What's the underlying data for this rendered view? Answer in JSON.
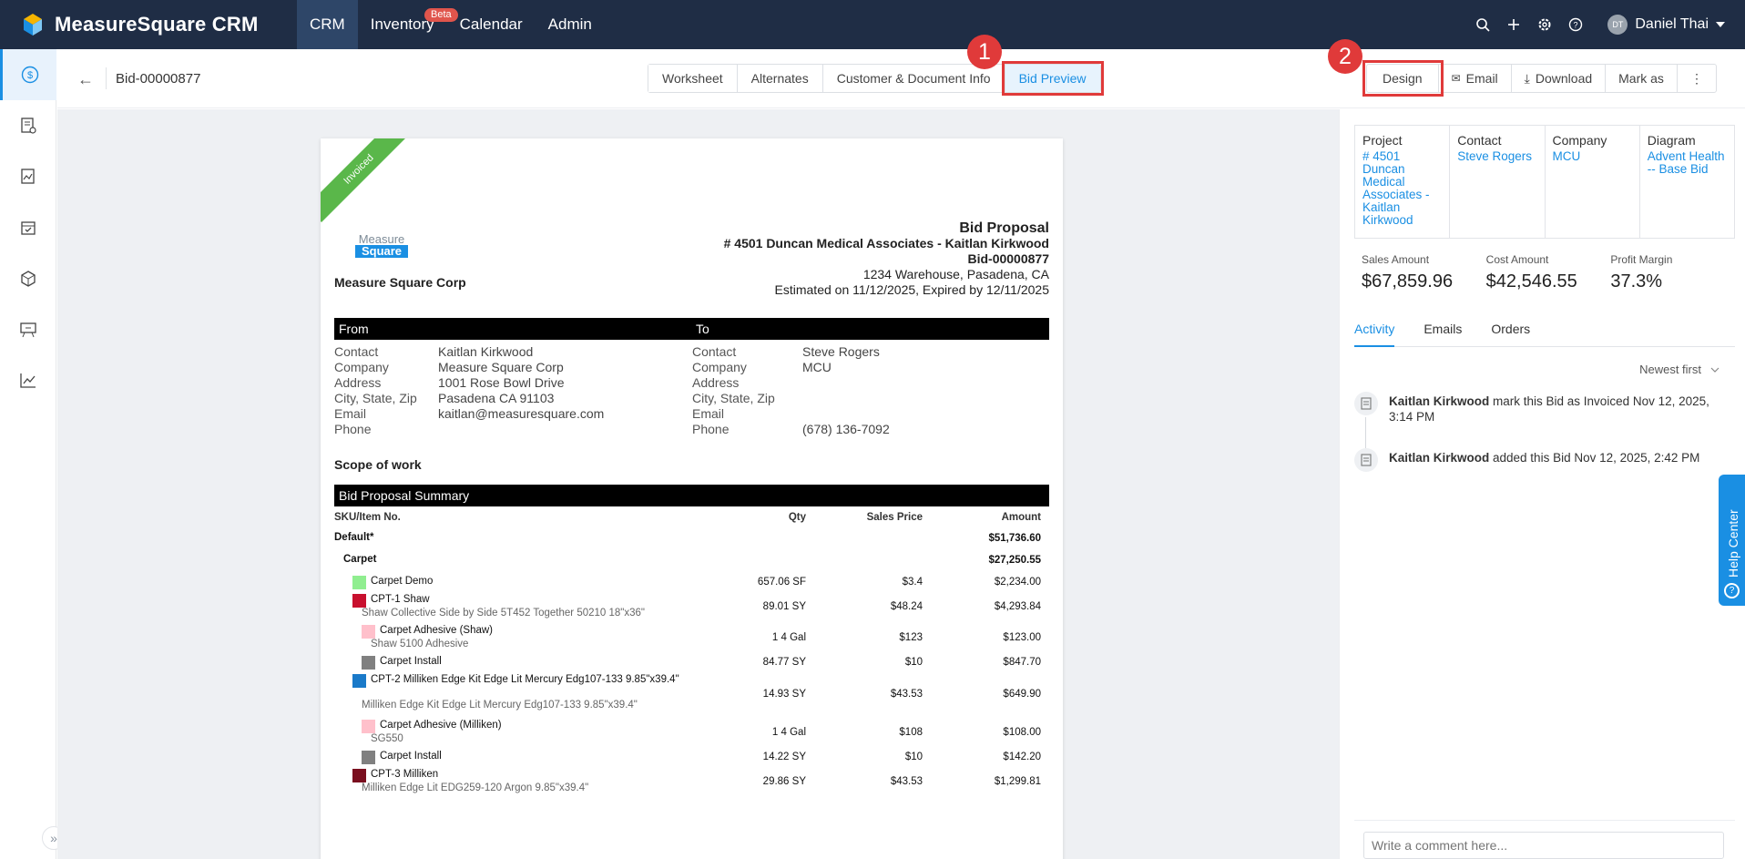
{
  "app": {
    "name": "MeasureSquare CRM",
    "nav": [
      {
        "label": "CRM",
        "active": true
      },
      {
        "label": "Inventory",
        "badge": "Beta"
      },
      {
        "label": "Calendar"
      },
      {
        "label": "Admin"
      }
    ],
    "user": {
      "initials": "DT",
      "name": "Daniel Thai"
    },
    "top_icons": [
      "search-icon",
      "plus-icon",
      "gear-icon",
      "help-icon"
    ]
  },
  "sidebar": {
    "items": [
      "dollar-icon",
      "estimate-icon",
      "document-icon",
      "calendar-check-icon",
      "box-icon",
      "presentation-icon",
      "chart-icon"
    ],
    "expand": "»"
  },
  "header": {
    "back": "←",
    "bid_id": "Bid-00000877",
    "tabs": [
      {
        "label": "Worksheet"
      },
      {
        "label": "Alternates"
      },
      {
        "label": "Customer & Document Info"
      },
      {
        "label": "Bid Preview",
        "active": true
      }
    ],
    "actions": [
      {
        "label": "Design",
        "icon": ""
      },
      {
        "label": "Email",
        "icon": "✉"
      },
      {
        "label": "Download",
        "icon": "⤓"
      },
      {
        "label": "Mark as",
        "icon": ""
      },
      {
        "label": "⋮",
        "icon": ""
      }
    ],
    "badge1": "1",
    "badge2": "2"
  },
  "doc": {
    "ribbon": "Invoiced",
    "logo_top": "Measure",
    "logo_bottom": "Square",
    "company": "Measure Square Corp",
    "title": "Bid Proposal",
    "project": "# 4501 Duncan Medical Associates - Kaitlan Kirkwood",
    "bid": "Bid-00000877",
    "address": "1234 Warehouse, Pasadena, CA",
    "dates": "Estimated on 11/12/2025, Expired by 12/11/2025",
    "from_label": "From",
    "to_label": "To",
    "from": [
      {
        "k": "Contact",
        "v": "Kaitlan Kirkwood"
      },
      {
        "k": "Company",
        "v": "Measure Square Corp"
      },
      {
        "k": "Address",
        "v": "1001 Rose Bowl Drive"
      },
      {
        "k": "City, State, Zip",
        "v": "Pasadena CA 91103"
      },
      {
        "k": "Email",
        "v": "kaitlan@measuresquare.com"
      },
      {
        "k": "Phone",
        "v": ""
      }
    ],
    "to": [
      {
        "k": "Contact",
        "v": "Steve Rogers"
      },
      {
        "k": "Company",
        "v": "MCU"
      },
      {
        "k": "Address",
        "v": ""
      },
      {
        "k": "City, State, Zip",
        "v": ""
      },
      {
        "k": "Email",
        "v": ""
      },
      {
        "k": "Phone",
        "v": "(678) 136-7092"
      }
    ],
    "scope": "Scope of work",
    "summary_title": "Bid Proposal Summary",
    "columns": {
      "sku": "SKU/Item No.",
      "qty": "Qty",
      "price": "Sales Price",
      "amount": "Amount"
    },
    "rows": [
      {
        "name": "Default*",
        "amount": "$51,736.60",
        "level": 0,
        "bold": true
      },
      {
        "name": "Carpet",
        "amount": "$27,250.55",
        "level": 1,
        "bold": true
      },
      {
        "name": "Carpet Demo",
        "qty": "657.06 SF",
        "price": "$3.4",
        "amount": "$2,234.00",
        "level": 2,
        "color": "#90ee90"
      },
      {
        "name": "CPT-1 Shaw",
        "sub": "Shaw Collective Side by Side 5T452 Together 50210 18\"x36\"",
        "qty": "89.01 SY",
        "price": "$48.24",
        "amount": "$4,293.84",
        "level": 2,
        "color": "#c8102e"
      },
      {
        "name": "Carpet Adhesive (Shaw)",
        "sub": "Shaw 5100 Adhesive",
        "qty": "1 4 Gal",
        "price": "$123",
        "amount": "$123.00",
        "level": 3,
        "color": "#ffc0cb"
      },
      {
        "name": "Carpet Install",
        "qty": "84.77 SY",
        "price": "$10",
        "amount": "$847.70",
        "level": 3,
        "color": "#808080"
      },
      {
        "name": "CPT-2 Milliken Edge Kit Edge Lit Mercury Edg107-133 9.85\"x39.4\"",
        "sub": "Milliken Edge Kit Edge Lit Mercury Edg107-133 9.85\"x39.4\"",
        "qty": "14.93 SY",
        "price": "$43.53",
        "amount": "$649.90",
        "level": 2,
        "color": "#1a7ac9"
      },
      {
        "name": "Carpet Adhesive (Milliken)",
        "sub": "SG550",
        "qty": "1 4 Gal",
        "price": "$108",
        "amount": "$108.00",
        "level": 3,
        "color": "#ffc0cb"
      },
      {
        "name": "Carpet Install",
        "qty": "14.22 SY",
        "price": "$10",
        "amount": "$142.20",
        "level": 3,
        "color": "#808080"
      },
      {
        "name": "CPT-3 Milliken",
        "sub": "Milliken Edge Lit EDG259-120 Argon 9.85\"x39.4\"",
        "qty": "29.86 SY",
        "price": "$43.53",
        "amount": "$1,299.81",
        "level": 2,
        "color": "#7a0f1f"
      }
    ]
  },
  "panel": {
    "cards": [
      {
        "h": "Project",
        "v": "# 4501 Duncan Medical Associates - Kaitlan Kirkwood"
      },
      {
        "h": "Contact",
        "v": "Steve Rogers"
      },
      {
        "h": "Company",
        "v": "MCU"
      },
      {
        "h": "Diagram",
        "v": "Advent Health -- Base Bid"
      }
    ],
    "stats": [
      {
        "h": "Sales Amount",
        "v": "$67,859.96"
      },
      {
        "h": "Cost Amount",
        "v": "$42,546.55"
      },
      {
        "h": "Profit Margin",
        "v": "37.3%"
      }
    ],
    "tabs": [
      {
        "label": "Activity",
        "active": true
      },
      {
        "label": "Emails"
      },
      {
        "label": "Orders"
      }
    ],
    "sort": "Newest first",
    "activity": [
      {
        "who": "Kaitlan Kirkwood",
        "what": " mark this Bid as Invoiced Nov 12, 2025, 3:14 PM"
      },
      {
        "who": "Kaitlan Kirkwood",
        "what": " added this Bid Nov 12, 2025, 2:42 PM"
      }
    ],
    "comment_placeholder": "Write a comment here..."
  },
  "help": {
    "label": "Help Center"
  }
}
